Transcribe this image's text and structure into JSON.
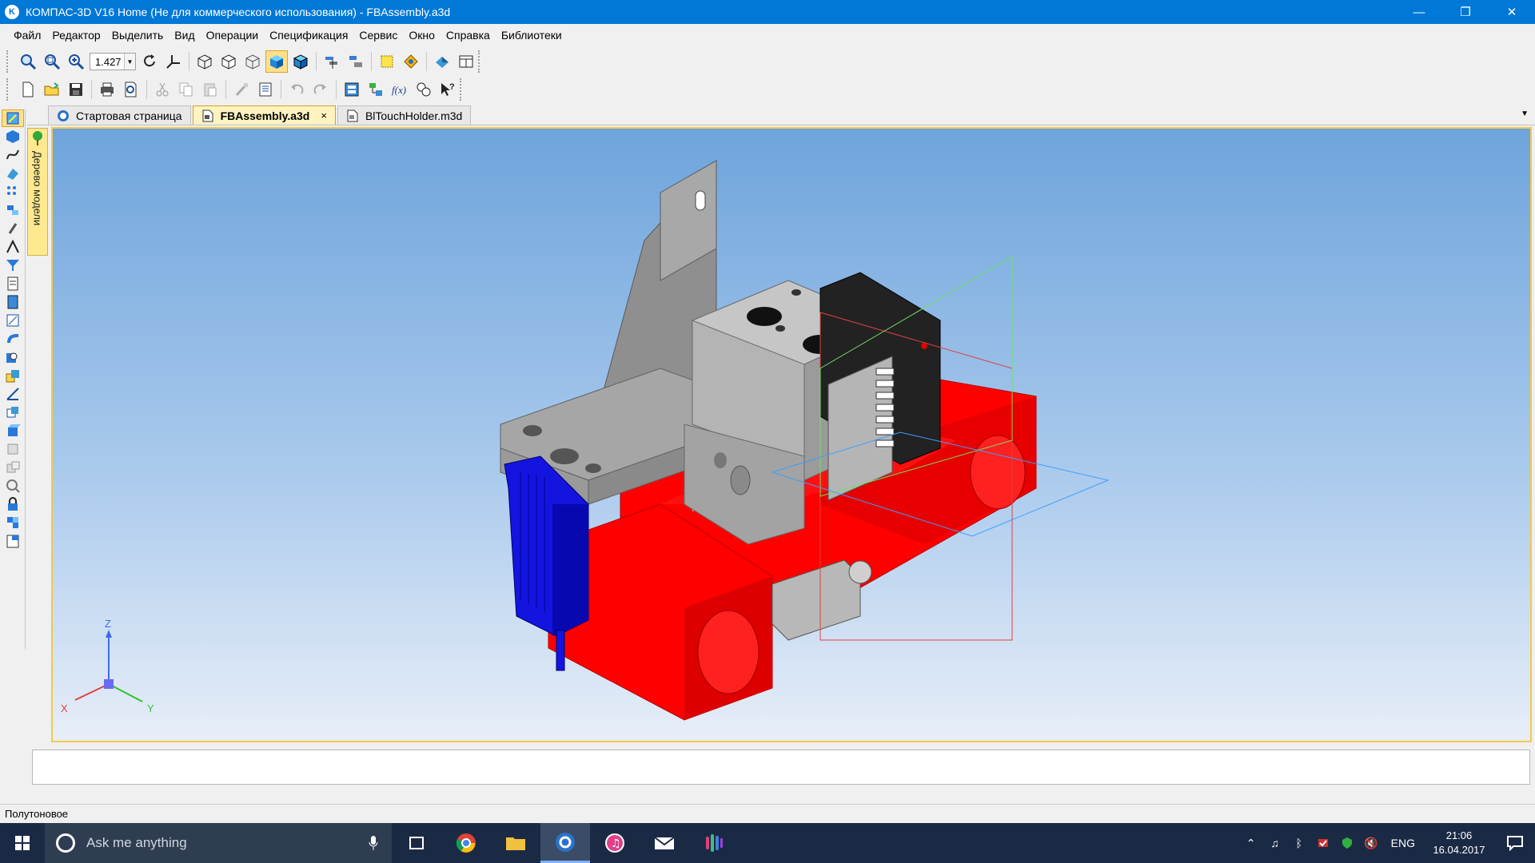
{
  "window": {
    "title": "КОМПАС-3D V16 Home  (Не для коммерческого использования) - FBAssembly.a3d",
    "app_icon_letter": "K",
    "minimize": "—",
    "restore": "❐",
    "close": "✕"
  },
  "menu": {
    "items": [
      "Файл",
      "Редактор",
      "Выделить",
      "Вид",
      "Операции",
      "Спецификация",
      "Сервис",
      "Окно",
      "Справка",
      "Библиотеки"
    ]
  },
  "toolbar": {
    "zoom_value": "1.427"
  },
  "tabs": [
    {
      "label": "Стартовая страница",
      "icon": "kompas-logo-icon"
    },
    {
      "label": "FBAssembly.a3d",
      "icon": "assembly-file-icon",
      "close": "×"
    },
    {
      "label": "BlTouchHolder.m3d",
      "icon": "part-file-icon"
    }
  ],
  "tree_panel": {
    "label": "Дерево модели"
  },
  "axes": {
    "x": "X",
    "y": "Y",
    "z": "Z"
  },
  "statusbar": {
    "text": "Полутоновое"
  },
  "taskbar": {
    "search_placeholder": "Ask me anything",
    "lang": "ENG",
    "time": "21:06",
    "date": "16.04.2017"
  },
  "colors": {
    "titlebar": "#0078d7",
    "viewport_top": "#6ea4dc",
    "viewport_bottom": "#e7eef8",
    "part_red": "#ff0000",
    "part_gray": "#a6a6a6",
    "part_blue": "#1010d8",
    "taskbar": "#1b2a44"
  }
}
